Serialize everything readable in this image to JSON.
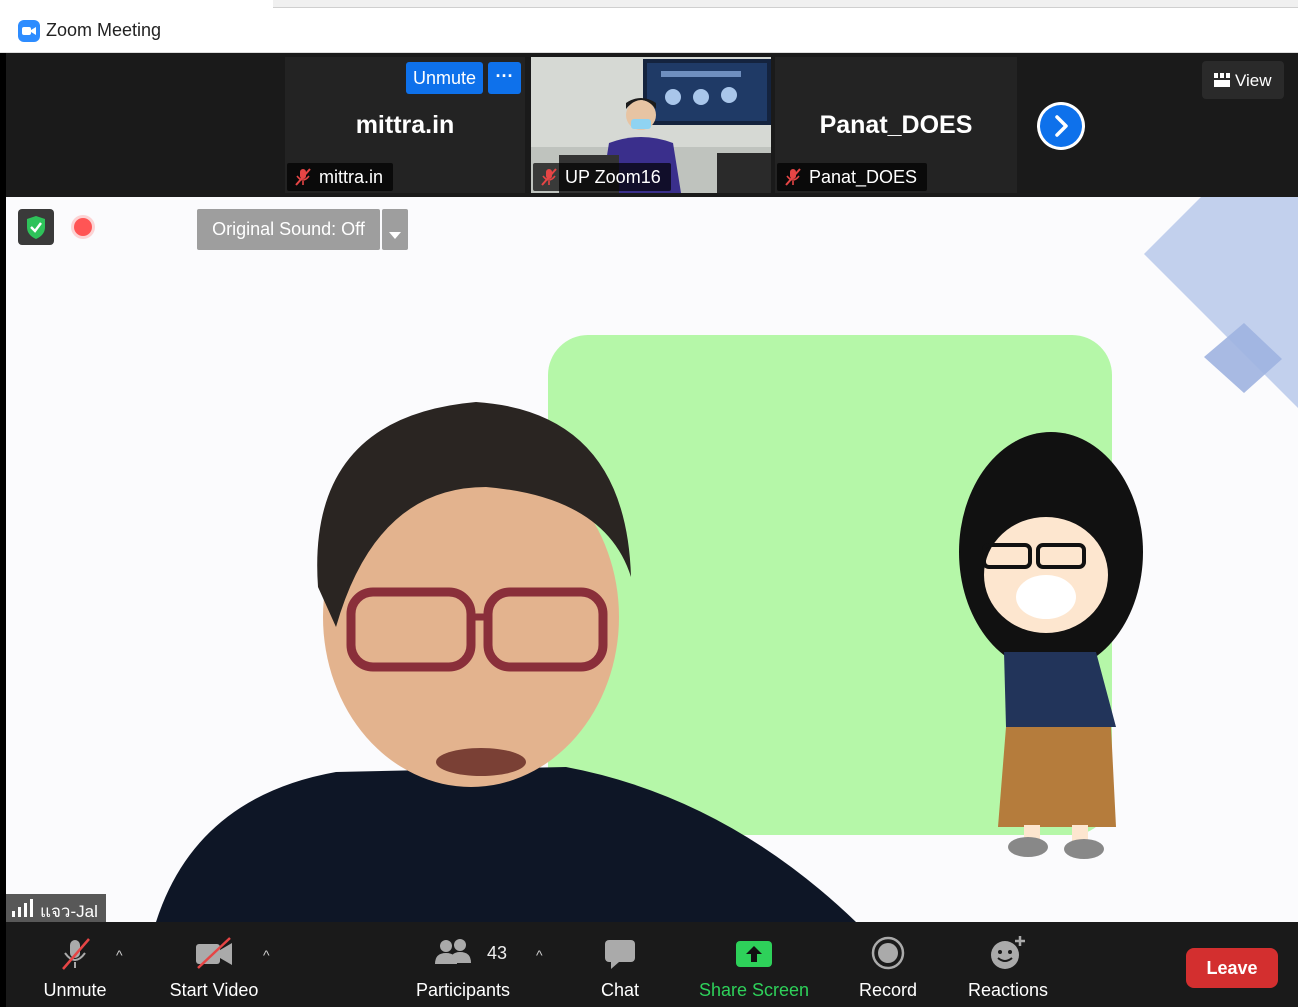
{
  "window": {
    "title": "Zoom Meeting"
  },
  "strip": {
    "tile1": {
      "big_name": "mittra.in",
      "label": "mittra.in",
      "unmute": "Unmute",
      "more": "···"
    },
    "tile2": {
      "label": "UP Zoom16"
    },
    "tile3": {
      "big_name": "Panat_DOES",
      "label": "Panat_DOES"
    },
    "view_label": "View"
  },
  "main": {
    "original_sound": "Original Sound: Off",
    "speaker_name": "แจว-Jal"
  },
  "toolbar": {
    "unmute": "Unmute",
    "start_video": "Start Video",
    "participants": "Participants",
    "participants_count": "43",
    "chat": "Chat",
    "share_screen": "Share Screen",
    "record": "Record",
    "reactions": "Reactions",
    "leave": "Leave"
  },
  "colors": {
    "accent": "#0e71eb",
    "share_green": "#2ed15a",
    "leave_red": "#d32f2f"
  },
  "icons": [
    "zoom-app-icon",
    "mic-muted-icon",
    "grid-view-icon",
    "chevron-right-icon",
    "shield-check-icon",
    "recording-icon",
    "caret-down-icon",
    "signal-bars-icon",
    "video-muted-icon",
    "participants-icon",
    "chat-icon",
    "share-screen-icon",
    "record-icon",
    "reactions-icon"
  ]
}
